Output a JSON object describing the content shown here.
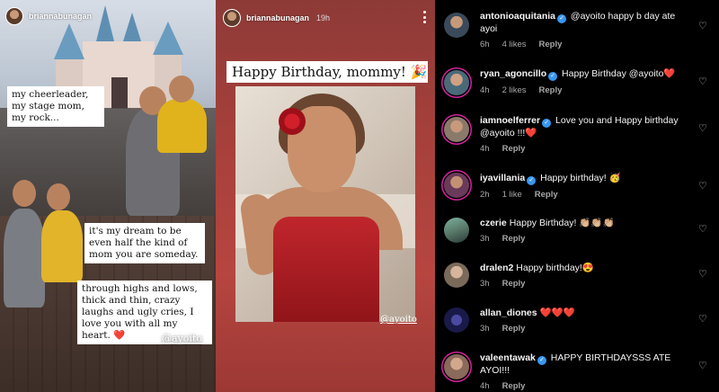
{
  "story1": {
    "username": "briannabunagan",
    "caption1": "my cheerleader, my stage mom, my rock...",
    "caption2": "it's my dream to be even half the kind of mom you are someday.",
    "caption3": "through highs and lows, thick and thin, crazy laughs and ugly cries, I love you with all my heart. ❤️",
    "mention": "@ayoito"
  },
  "story2": {
    "username": "briannabunagan",
    "time": "19h",
    "title": "Happy Birthday, mommy! 🎉",
    "mention": "@ayoito"
  },
  "comments": [
    {
      "user": "antonioaquitania",
      "verified": true,
      "text": "@ayoito happy b day ate ayoi",
      "time": "6h",
      "likes": "4 likes",
      "reply": "Reply",
      "avatar_color": "#3a4a5a"
    },
    {
      "user": "ryan_agoncillo",
      "verified": true,
      "text": "Happy Birthday @ayoito❤️",
      "time": "4h",
      "likes": "2 likes",
      "reply": "Reply",
      "avatar_color": "#4a6a7a"
    },
    {
      "user": "iamnoelferrer",
      "verified": true,
      "text": "Love you and Happy birthday @ayoito !!!❤️",
      "time": "4h",
      "likes": "",
      "reply": "Reply",
      "avatar_color": "#8a7a6a"
    },
    {
      "user": "iyavillania",
      "verified": true,
      "text": "Happy birthday! 🥳",
      "time": "2h",
      "likes": "1 like",
      "reply": "Reply",
      "avatar_color": "#6a3a5a"
    },
    {
      "user": "czerie",
      "verified": false,
      "text": "Happy Birthday! 👏🏼👏🏼👏🏼",
      "time": "3h",
      "likes": "",
      "reply": "Reply",
      "avatar_color": "#5a7a6a"
    },
    {
      "user": "dralen2",
      "verified": false,
      "text": "Happy birthday!😍",
      "time": "3h",
      "likes": "",
      "reply": "Reply",
      "avatar_color": "#7a6a5a"
    },
    {
      "user": "allan_diones",
      "verified": false,
      "text": "❤️❤️❤️",
      "time": "3h",
      "likes": "",
      "reply": "Reply",
      "avatar_color": "#2a2a5a"
    },
    {
      "user": "valeentawak",
      "verified": true,
      "text": "HAPPY BIRTHDAYSSS ATE AYOI!!!",
      "time": "4h",
      "likes": "",
      "reply": "Reply",
      "avatar_color": "#8a6a5a"
    }
  ],
  "icons": {
    "heart": "heart-outline-icon",
    "verified": "verified-badge-icon",
    "more": "more-options-icon"
  }
}
